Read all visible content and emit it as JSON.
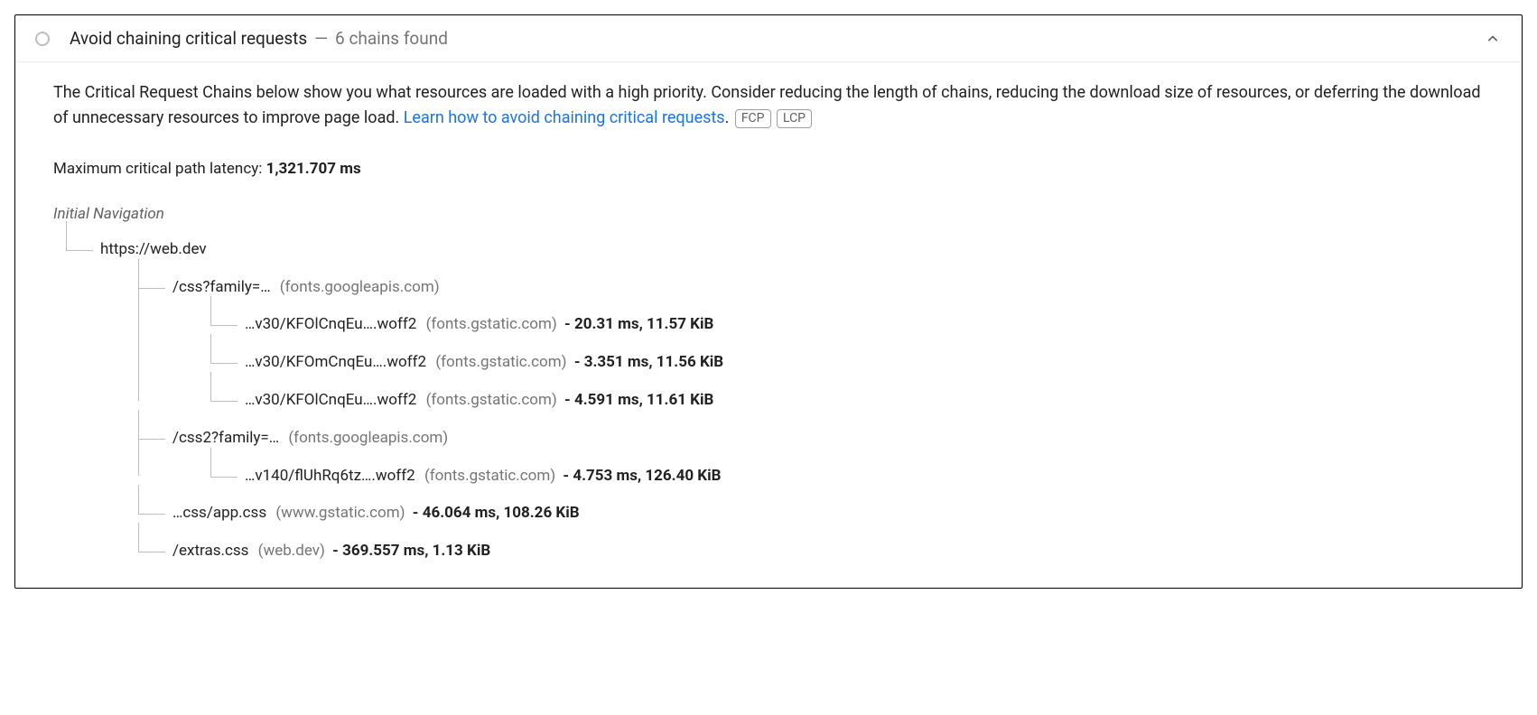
{
  "header": {
    "title": "Avoid chaining critical requests",
    "dash": "—",
    "count": "6 chains found"
  },
  "description": {
    "text_before": "The Critical Request Chains below show you what resources are loaded with a high priority. Consider reducing the length of chains, reducing the download size of resources, or deferring the download of unnecessary resources to improve page load. ",
    "link_text": "Learn how to avoid chaining critical requests",
    "period": ".",
    "badges": [
      "FCP",
      "LCP"
    ]
  },
  "latency": {
    "label": "Maximum critical path latency: ",
    "value": "1,321.707 ms"
  },
  "tree": {
    "root": "Initial Navigation",
    "n0": {
      "path": "https://web.dev"
    },
    "n1": {
      "path": "/css?family=…",
      "host": "(fonts.googleapis.com)"
    },
    "n1a": {
      "path": "…v30/KFOlCnqEu….woff2",
      "host": "(fonts.gstatic.com)",
      "stats": "- 20.31 ms, 11.57 KiB"
    },
    "n1b": {
      "path": "…v30/KFOmCnqEu….woff2",
      "host": "(fonts.gstatic.com)",
      "stats": "- 3.351 ms, 11.56 KiB"
    },
    "n1c": {
      "path": "…v30/KFOlCnqEu….woff2",
      "host": "(fonts.gstatic.com)",
      "stats": "- 4.591 ms, 11.61 KiB"
    },
    "n2": {
      "path": "/css2?family=…",
      "host": "(fonts.googleapis.com)"
    },
    "n2a": {
      "path": "…v140/flUhRq6tz….woff2",
      "host": "(fonts.gstatic.com)",
      "stats": "- 4.753 ms, 126.40 KiB"
    },
    "n3": {
      "path": "…css/app.css",
      "host": "(www.gstatic.com)",
      "stats": "- 46.064 ms, 108.26 KiB"
    },
    "n4": {
      "path": "/extras.css",
      "host": "(web.dev)",
      "stats": "- 369.557 ms, 1.13 KiB"
    }
  }
}
